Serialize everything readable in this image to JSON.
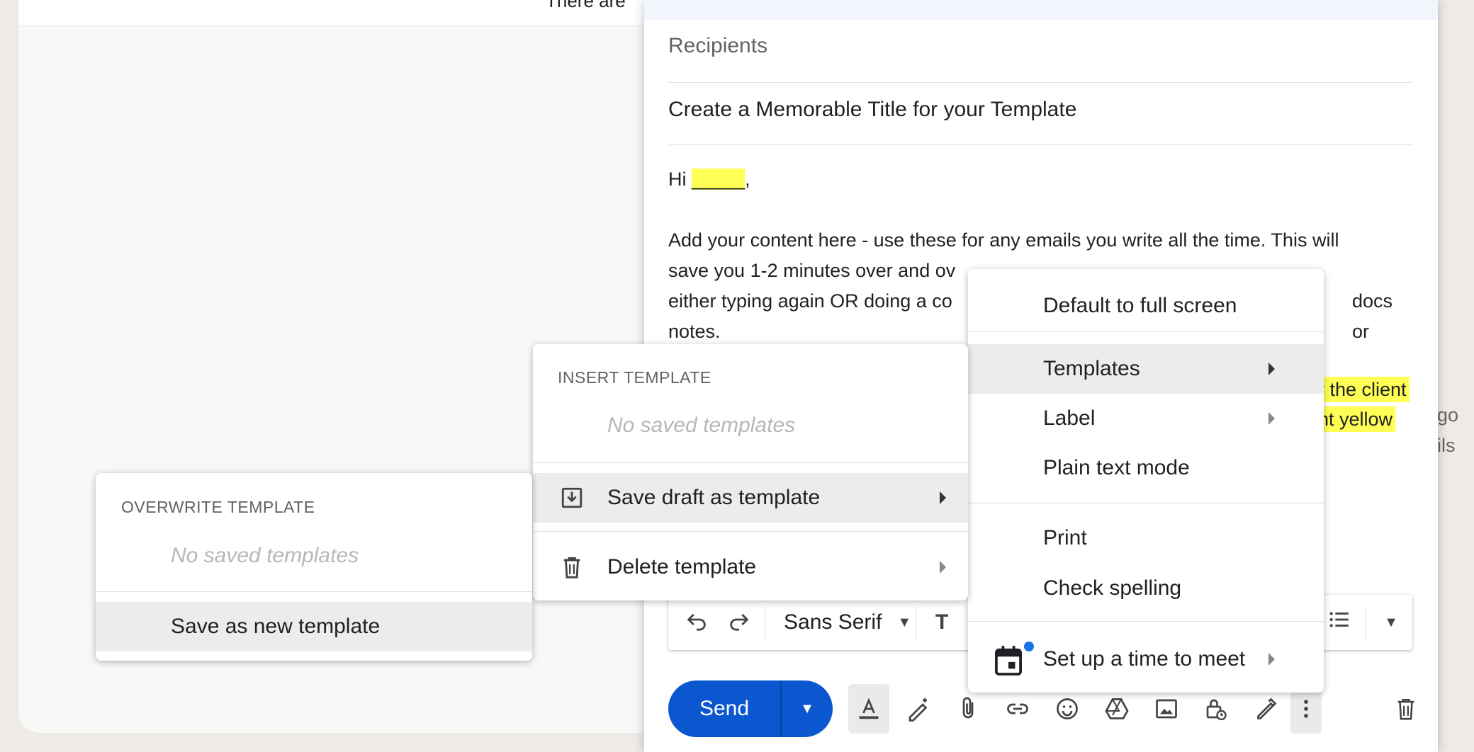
{
  "background": {
    "peek_text": "There are",
    "right_peek_1": "go",
    "right_peek_2": "ils"
  },
  "compose": {
    "recipients_placeholder": "Recipients",
    "subject": "Create a Memorable Title for your Template",
    "greeting_prefix": "Hi ",
    "greeting_blank": "_____",
    "greeting_suffix": ",",
    "paragraph_line_1": "Add your content here - use these for any emails you write all the time. This will",
    "paragraph_line_2": "save you 1-2 minutes over and ov",
    "paragraph_line_3": "either typing again OR doing a co",
    "paragraph_line_3_end": "docs or",
    "paragraph_line_4": "notes.",
    "highlight_1": "r the client",
    "highlight_2": "ht yellow"
  },
  "format_toolbar": {
    "font_name": "Sans Serif"
  },
  "send": {
    "label": "Send"
  },
  "more_options_menu": {
    "items": {
      "default_full_screen": "Default to full screen",
      "templates": "Templates",
      "label": "Label",
      "plain_text": "Plain text mode",
      "print": "Print",
      "check_spelling": "Check spelling",
      "meet": "Set up a time to meet"
    }
  },
  "templates_menu": {
    "header": "INSERT TEMPLATE",
    "empty": "No saved templates",
    "save_draft": "Save draft as template",
    "delete": "Delete template"
  },
  "save_draft_menu": {
    "header": "OVERWRITE TEMPLATE",
    "empty": "No saved templates",
    "save_new": "Save as new template"
  },
  "colors": {
    "accent": "#0b57d0",
    "highlight": "#ffff55",
    "menu_hover": "#ececec",
    "notification_dot": "#1a73e8"
  }
}
